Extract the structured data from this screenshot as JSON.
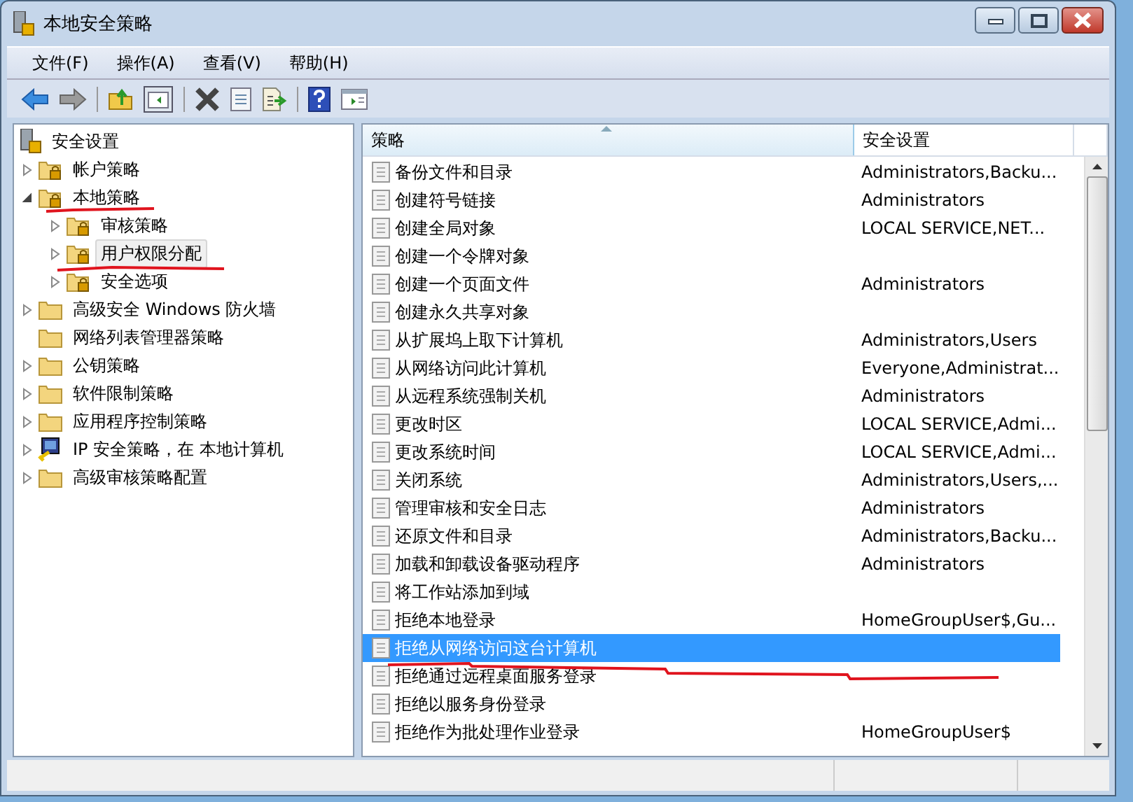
{
  "window": {
    "title": "本地安全策略"
  },
  "menu": [
    "文件(F)",
    "操作(A)",
    "查看(V)",
    "帮助(H)"
  ],
  "tree": {
    "items": [
      {
        "label": "安全设置",
        "kind": "root",
        "selected": false,
        "children": [
          {
            "label": "帐户策略",
            "kind": "lock-folder",
            "expanded": false,
            "selected": false
          },
          {
            "label": "本地策略",
            "kind": "lock-folder",
            "expanded": true,
            "selected": false,
            "children": [
              {
                "label": "审核策略",
                "kind": "lock-folder",
                "expanded": false,
                "selected": false
              },
              {
                "label": "用户权限分配",
                "kind": "lock-folder",
                "expanded": false,
                "selected": true
              },
              {
                "label": "安全选项",
                "kind": "lock-folder",
                "expanded": false,
                "selected": false
              }
            ]
          },
          {
            "label": "高级安全 Windows 防火墙",
            "kind": "folder",
            "expanded": false,
            "selected": false
          },
          {
            "label": "网络列表管理器策略",
            "kind": "folder",
            "selected": false
          },
          {
            "label": "公钥策略",
            "kind": "folder",
            "expanded": false,
            "selected": false
          },
          {
            "label": "软件限制策略",
            "kind": "folder",
            "expanded": false,
            "selected": false
          },
          {
            "label": "应用程序控制策略",
            "kind": "folder",
            "expanded": false,
            "selected": false
          },
          {
            "label": "IP 安全策略，在 本地计算机",
            "kind": "ip",
            "expanded": false,
            "selected": false
          },
          {
            "label": "高级审核策略配置",
            "kind": "folder",
            "expanded": false,
            "selected": false
          }
        ]
      }
    ]
  },
  "table": {
    "columns": [
      "策略",
      "安全设置"
    ],
    "rows": [
      {
        "policy": "备份文件和目录",
        "setting": "Administrators,Backu...",
        "selected": false
      },
      {
        "policy": "创建符号链接",
        "setting": "Administrators",
        "selected": false
      },
      {
        "policy": "创建全局对象",
        "setting": "LOCAL SERVICE,NET...",
        "selected": false
      },
      {
        "policy": "创建一个令牌对象",
        "setting": "",
        "selected": false
      },
      {
        "policy": "创建一个页面文件",
        "setting": "Administrators",
        "selected": false
      },
      {
        "policy": "创建永久共享对象",
        "setting": "",
        "selected": false
      },
      {
        "policy": "从扩展坞上取下计算机",
        "setting": "Administrators,Users",
        "selected": false
      },
      {
        "policy": "从网络访问此计算机",
        "setting": "Everyone,Administrat...",
        "selected": false
      },
      {
        "policy": "从远程系统强制关机",
        "setting": "Administrators",
        "selected": false
      },
      {
        "policy": "更改时区",
        "setting": "LOCAL SERVICE,Admi...",
        "selected": false
      },
      {
        "policy": "更改系统时间",
        "setting": "LOCAL SERVICE,Admi...",
        "selected": false
      },
      {
        "policy": "关闭系统",
        "setting": "Administrators,Users,...",
        "selected": false
      },
      {
        "policy": "管理审核和安全日志",
        "setting": "Administrators",
        "selected": false
      },
      {
        "policy": "还原文件和目录",
        "setting": "Administrators,Backu...",
        "selected": false
      },
      {
        "policy": "加载和卸载设备驱动程序",
        "setting": "Administrators",
        "selected": false
      },
      {
        "policy": "将工作站添加到域",
        "setting": "",
        "selected": false
      },
      {
        "policy": "拒绝本地登录",
        "setting": "HomeGroupUser$,Gu...",
        "selected": false
      },
      {
        "policy": "拒绝从网络访问这台计算机",
        "setting": "",
        "selected": true
      },
      {
        "policy": "拒绝通过远程桌面服务登录",
        "setting": "",
        "selected": false
      },
      {
        "policy": "拒绝以服务身份登录",
        "setting": "",
        "selected": false
      },
      {
        "policy": "拒绝作为批处理作业登录",
        "setting": "HomeGroupUser$",
        "selected": false
      }
    ]
  }
}
